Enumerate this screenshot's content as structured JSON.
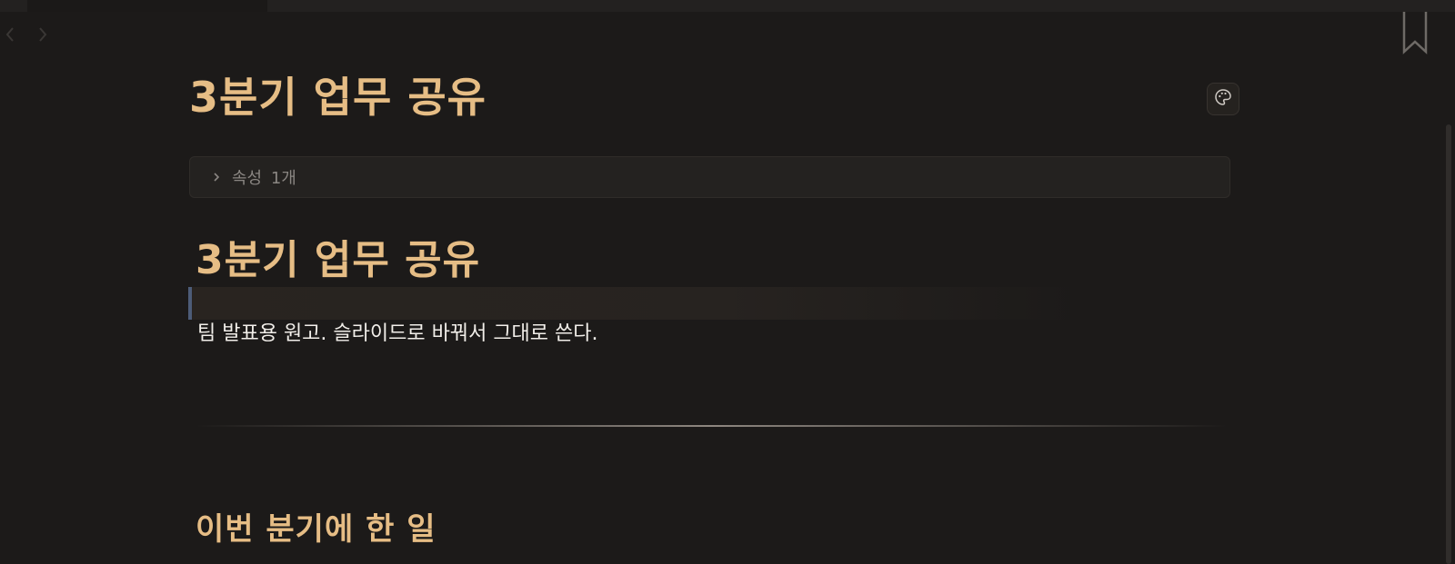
{
  "window": {
    "nav_back_icon": "chevron-left-icon",
    "nav_forward_icon": "chevron-right-icon",
    "bookmark_icon": "bookmark-icon",
    "style_icon": "palette-icon"
  },
  "note": {
    "title": "3분기 업무 공유",
    "properties_label": "속성 1개",
    "heading1": "3분기 업무 공유",
    "paragraph": "팀 발표용 원고. 슬라이드로 바꿔서 그대로 쓴다.",
    "heading2": "이번 분기에 한 일"
  },
  "colors": {
    "background": "#1c1a19",
    "heading": "#e6bd85",
    "body_text": "#f2efea",
    "muted_text": "#8a8682",
    "callout_accent": "#4d5c78"
  }
}
